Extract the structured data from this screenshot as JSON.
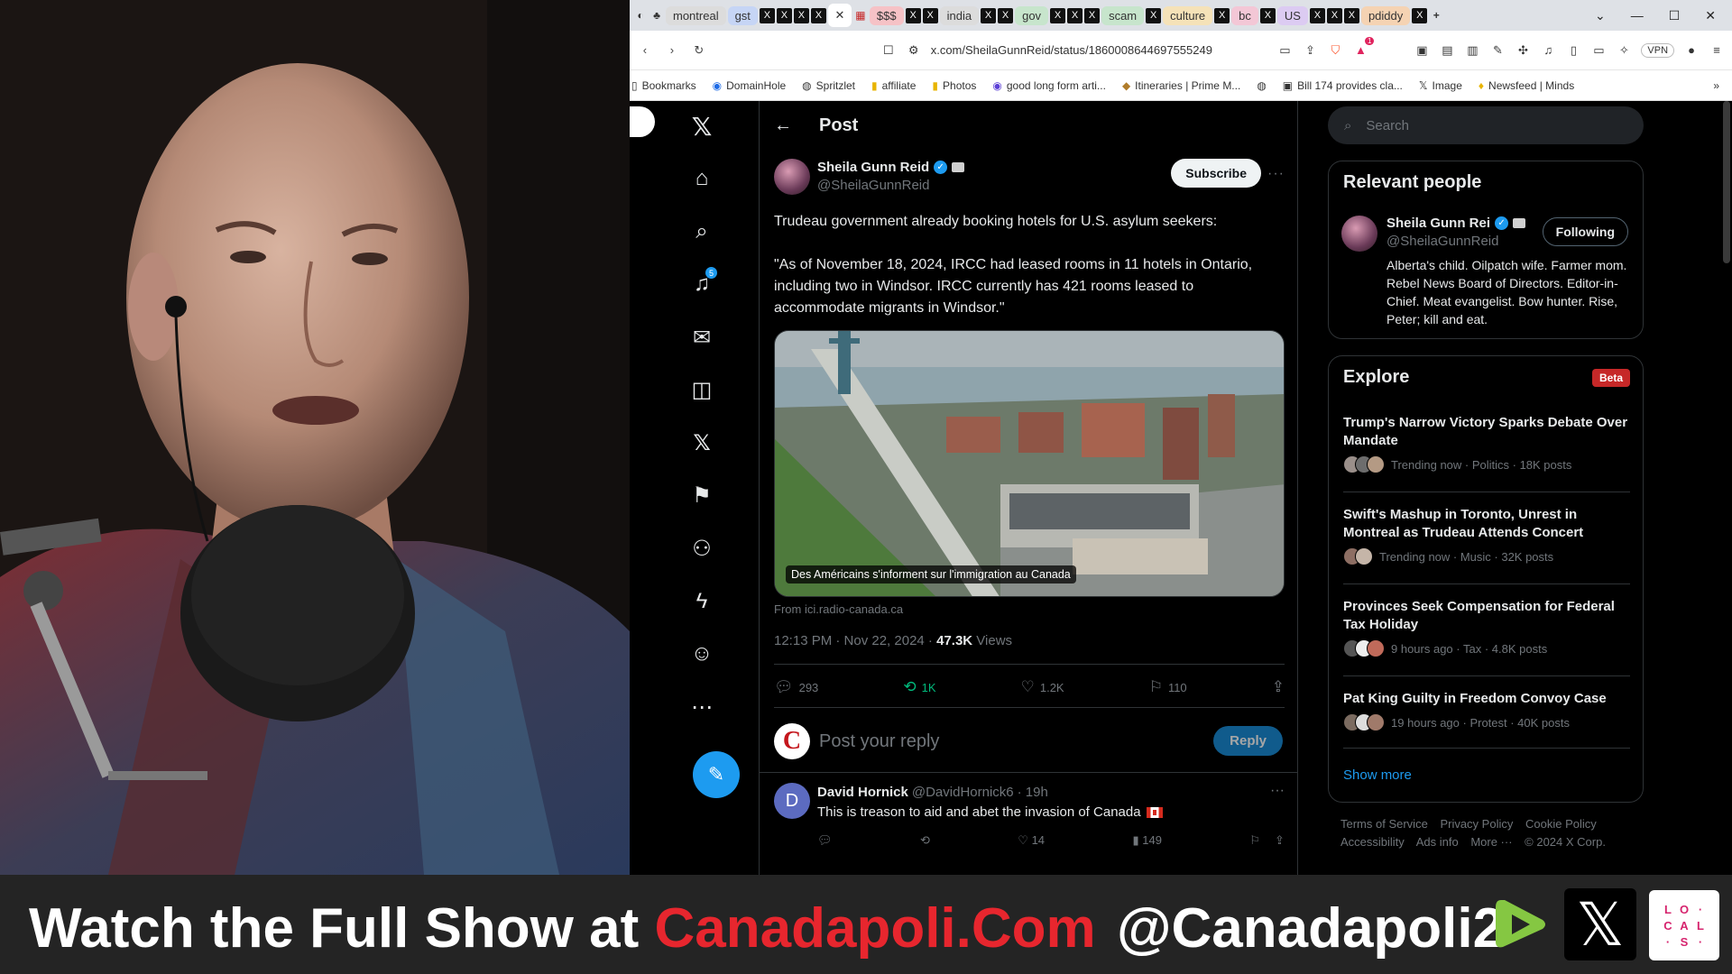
{
  "browser": {
    "tab_groups": [
      "montreal",
      "gst",
      "$$$",
      "india",
      "gov",
      "scam",
      "culture",
      "bc",
      "US",
      "pdiddy"
    ],
    "tab_group_colors": [
      "#dcdcdc",
      "#c6d5f5",
      "#f6c2c6",
      "#dcdcdc",
      "#c7e5cc",
      "#c7e5cc",
      "#f5e2b8",
      "#f3c7d6",
      "#dccbf2",
      "#f5d3b3"
    ],
    "address": "x.com/SheilaGunnReid/status/1860008644697555249",
    "vpn_label": "VPN",
    "notification_count": "1",
    "bookmarks": [
      {
        "label": "Bookmarks",
        "icon": "folder-icon"
      },
      {
        "label": "DomainHole",
        "icon": "globe-icon"
      },
      {
        "label": "Spritzlet",
        "icon": "globe-icon"
      },
      {
        "label": "affiliate",
        "icon": "folder-icon"
      },
      {
        "label": "Photos",
        "icon": "folder-icon"
      },
      {
        "label": "good long form arti...",
        "icon": "globe-icon"
      },
      {
        "label": "Itineraries | Prime M...",
        "icon": "globe-icon"
      },
      {
        "label": "",
        "icon": "globe-icon"
      },
      {
        "label": "Bill 174 provides cla...",
        "icon": "globe-icon"
      },
      {
        "label": "Image",
        "icon": "x-icon"
      },
      {
        "label": "Newsfeed | Minds",
        "icon": "bulb-icon"
      }
    ]
  },
  "nav": {
    "notification_badge": "5"
  },
  "post": {
    "header_title": "Post",
    "author_name": "Sheila Gunn Reid",
    "author_handle": "@SheilaGunnReid",
    "subscribe_label": "Subscribe",
    "text_line1": "Trudeau government already booking hotels for U.S. asylum seekers:",
    "text_line2": "\"As of November 18, 2024, IRCC had leased rooms in 11 hotels in Ontario, including two in Windsor. IRCC currently has 421 rooms leased to accommodate migrants in Windsor.\"",
    "media_caption": "Des Américains s'informent sur l'immigration au Canada",
    "media_source": "From ici.radio-canada.ca",
    "time": "12:13 PM · Nov 22, 2024 · ",
    "views_count": "47.3K",
    "views_label": " Views",
    "replies": "293",
    "reposts": "1K",
    "likes": "1.2K",
    "bookmarks": "110",
    "reply_placeholder": "Post your reply",
    "reply_button": "Reply"
  },
  "comment": {
    "avatar_letter": "D",
    "name": "David Hornick",
    "handle": "@DavidHornick6",
    "age": "· 19h",
    "text": "This is treason to aid and abet the invasion of Canada",
    "likes": "14",
    "views": "149"
  },
  "sidebar": {
    "search_placeholder": "Search",
    "relevant_title": "Relevant people",
    "rp_name": "Sheila Gunn Rei",
    "rp_handle": "@SheilaGunnReid",
    "rp_follow": "Following",
    "rp_bio": "Alberta's child. Oilpatch wife. Farmer mom. Rebel News Board of Directors. Editor-in-Chief. Meat evangelist. Bow hunter. Rise, Peter; kill and eat.",
    "explore_title": "Explore",
    "explore_badge": "Beta",
    "trends": [
      {
        "title": "Trump's Narrow Victory Sparks Debate Over Mandate",
        "meta": "Trending now · Politics · 18K posts"
      },
      {
        "title": "Swift's Mashup in Toronto, Unrest in Montreal as Trudeau Attends Concert",
        "meta": "Trending now · Music · 32K posts"
      },
      {
        "title": "Provinces Seek Compensation for Federal Tax Holiday",
        "meta": "9 hours ago · Tax · 4.8K posts"
      },
      {
        "title": "Pat King Guilty in Freedom Convoy Case",
        "meta": "19 hours ago · Protest · 40K posts"
      }
    ],
    "show_more": "Show more",
    "footer_links": [
      "Terms of Service",
      "Privacy Policy",
      "Cookie Policy",
      "Accessibility",
      "Ads info",
      "More ···",
      "© 2024 X Corp."
    ]
  },
  "banner": {
    "text_prefix": "Watch the Full Show at ",
    "text_site": "Canadapoli.Com",
    "handle": "@Canadapoli2",
    "locals_logo_text": "LOCALS",
    "colors": {
      "accent_red": "#e7262e",
      "rumble_green": "#85c742",
      "x_blue": "#1d9bf0"
    }
  }
}
